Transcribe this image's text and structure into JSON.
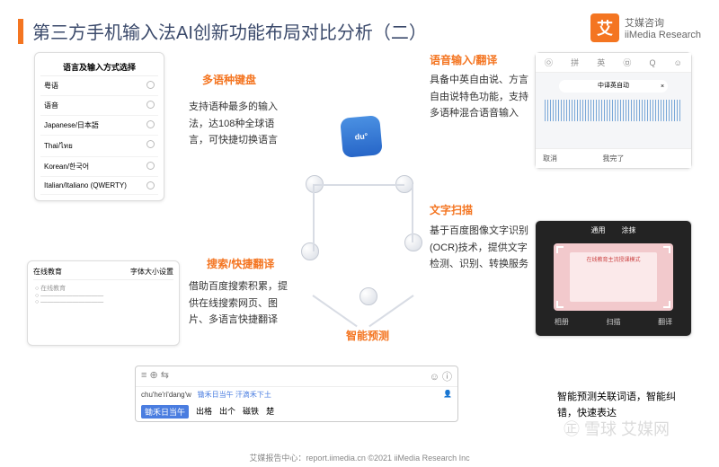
{
  "title": "第三方手机输入法AI创新功能布局对比分析（二）",
  "brand": {
    "cn": "艾媒咨询",
    "en": "iiMedia Research",
    "glyph": "艾"
  },
  "sections": {
    "kb": {
      "title": "多语种键盘",
      "body": "支持语种最多的输入法，达108种全球语言，可快捷切换语言"
    },
    "voice": {
      "title": "语音输入/翻译",
      "body": "具备中英自由说、方言自由说特色功能，支持多语种混合语音输入"
    },
    "search": {
      "title": "搜索/快捷翻译",
      "body": "借助百度搜索积累，提供在线搜索网页、图片、多语言快捷翻译"
    },
    "ocr": {
      "title": "文字扫描",
      "body": "基于百度图像文字识别(OCR)技术，提供文字检测、识别、转换服务"
    },
    "pred": {
      "title": "智能预测",
      "body": "智能预测关联词语，智能纠错，快速表达"
    }
  },
  "lang_card": {
    "header": "语言及输入方式选择",
    "items": [
      "粤语",
      "语音",
      "Japanese/日本語",
      "Thai/ไทย",
      "Korean/한국어",
      "Italian/Italiano (QWERTY)"
    ]
  },
  "search_card": {
    "tab_l": "在线教育",
    "tab_r": "字体大小设置"
  },
  "voice_card": {
    "tabs": [
      "㉧",
      "拼",
      "英",
      "㉤",
      "Q",
      "☺"
    ],
    "bubble": "中译英自动",
    "done": "我完了",
    "l": "取消"
  },
  "ocr_card": {
    "tabs": [
      "通用",
      "涂抹"
    ],
    "title": "在线教育主流授课模式",
    "bot": [
      "相册",
      "扫描",
      "翻译"
    ]
  },
  "ime": {
    "icons_l": "≡  ⊕  ⇆",
    "icons_r": "☺  ⓘ",
    "py": "chu'he'ri'dang'w",
    "context": "锄禾日当午 汗滴禾下土",
    "cands": [
      "锄禾日当午",
      "出格",
      "出个",
      "磁铁",
      "楚"
    ]
  },
  "center_logo": "du°",
  "watermark": "㊣ 雪球  艾媒网",
  "footer": "艾媒报告中心：report.iimedia.cn    ©2021 iiMedia Research Inc"
}
